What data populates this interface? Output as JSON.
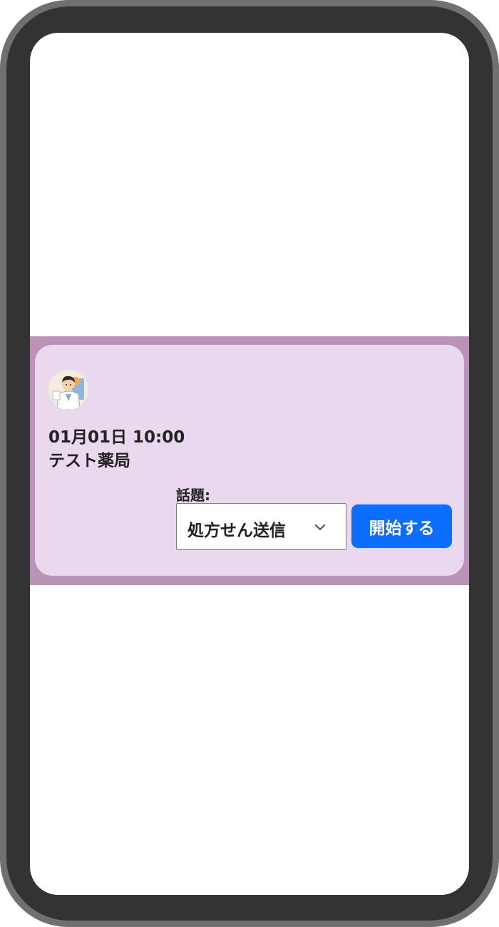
{
  "card": {
    "datetime": "01月01日 10:00",
    "pharmacy_name": "テスト薬局",
    "avatar_icon": "pharmacist-avatar-icon"
  },
  "topic": {
    "label": "話題:",
    "selected": "処方せん送信",
    "dropdown_icon": "chevron-down-icon"
  },
  "actions": {
    "start_label": "開始する"
  },
  "colors": {
    "band": "#bb93b8",
    "card": "#ead8ee",
    "button": "#0d6efd",
    "phone_frame": "#333333"
  }
}
